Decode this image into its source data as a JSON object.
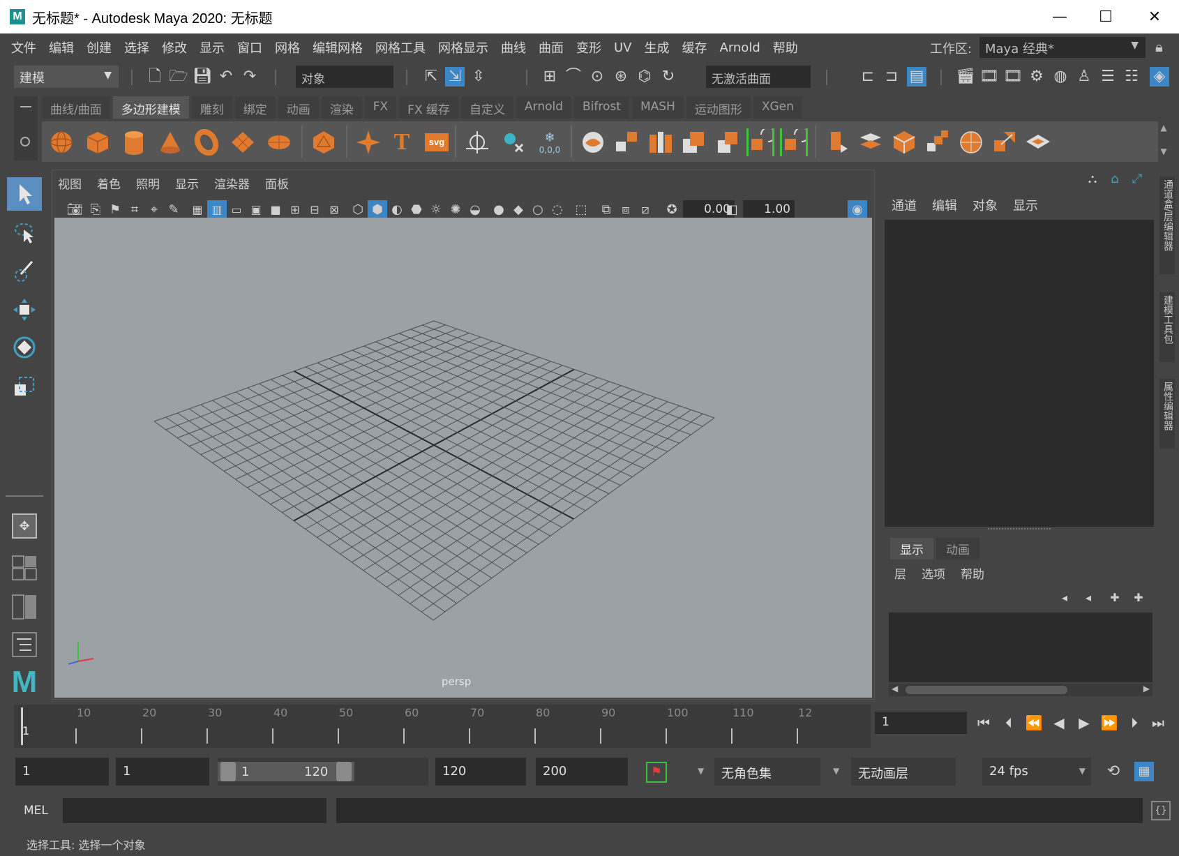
{
  "window": {
    "title": "无标题* - Autodesk Maya 2020: 无标题",
    "logo": "M",
    "minimize_icon": "—",
    "maximize_icon": "☐",
    "close_icon": "✕"
  },
  "menubar": {
    "items": [
      "文件",
      "编辑",
      "创建",
      "选择",
      "修改",
      "显示",
      "窗口",
      "网格",
      "编辑网格",
      "网格工具",
      "网格显示",
      "曲线",
      "曲面",
      "变形",
      "UV",
      "生成",
      "缓存",
      "Arnold",
      "帮助"
    ],
    "workspace_label": "工作区:",
    "workspace_value": "Maya 经典*"
  },
  "toolbar": {
    "mode": "建模",
    "object_field": "对象",
    "live_surface": "无激活曲面"
  },
  "shelf": {
    "tabs": [
      "曲线/曲面",
      "多边形建模",
      "雕刻",
      "绑定",
      "动画",
      "渲染",
      "FX",
      "FX 缓存",
      "自定义",
      "Arnold",
      "Bifrost",
      "MASH",
      "运动图形",
      "XGen"
    ],
    "active_tab": "多边形建模",
    "icons": [
      "poly-sphere-icon",
      "poly-cube-icon",
      "poly-cylinder-icon",
      "poly-cone-icon",
      "poly-torus-icon",
      "poly-plane-icon",
      "poly-disc-icon",
      "platonic-solid-icon",
      "super-shape-icon",
      "text-icon",
      "svg-icon",
      "center-pivot-icon",
      "delete-history-icon",
      "freeze-transform-icon",
      "combine-icon",
      "separate-icon",
      "smooth-icon",
      "boolean-icon",
      "extrude-icon",
      "bridge-icon",
      "bevel-icon",
      "merge-icon",
      "multicut-icon",
      "target-weld-icon",
      "quad-draw-icon",
      "cut-uv-icon",
      "unfold-icon",
      "layout-icon",
      "planar-map-icon",
      "uv-editor-icon"
    ],
    "svg_label": "svg",
    "text_label": "T",
    "origin_label": "0,0,0"
  },
  "viewport": {
    "menu": [
      "视图",
      "着色",
      "照明",
      "显示",
      "渲染器",
      "面板"
    ],
    "exposure": "0.00",
    "gamma": "1.00",
    "camera": "persp",
    "background_color": "#9ba1a5"
  },
  "channel_box": {
    "menu": [
      "通道",
      "编辑",
      "对象",
      "显示"
    ]
  },
  "layer_editor": {
    "tabs": [
      "显示",
      "动画"
    ],
    "menu": [
      "层",
      "选项",
      "帮助"
    ]
  },
  "side_tabs": [
    "通道盒/层编辑器",
    "建模工具包",
    "属性编辑器"
  ],
  "timeline": {
    "labels": [
      "10",
      "20",
      "30",
      "40",
      "50",
      "60",
      "70",
      "80",
      "90",
      "100",
      "110",
      "12"
    ],
    "start_label": "1",
    "current_frame": "1"
  },
  "range": {
    "start": "1",
    "playback_start": "1",
    "slider_min": "1",
    "slider_max": "120",
    "playback_end": "120",
    "end": "200",
    "character_set": "无角色集",
    "anim_layer": "无动画层",
    "fps": "24 fps"
  },
  "command_line": {
    "language": "MEL"
  },
  "help_line": "选择工具: 选择一个对象",
  "colors": {
    "accent": "#e07a2e",
    "ui_bg": "#444444",
    "field_bg": "#2b2b2b",
    "highlight": "#3d86c6"
  }
}
